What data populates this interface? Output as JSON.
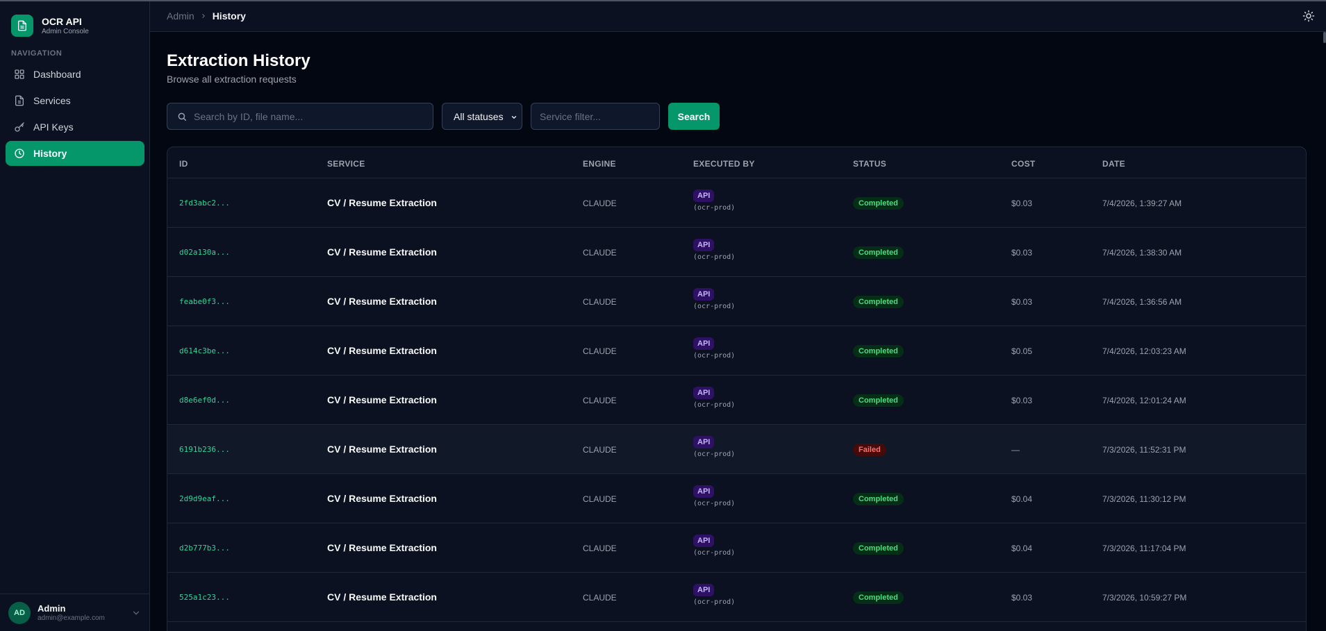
{
  "app": {
    "title": "OCR API",
    "subtitle": "Admin Console",
    "logo_icon": "document-icon"
  },
  "sidebar": {
    "heading": "NAVIGATION",
    "items": [
      {
        "label": "Dashboard",
        "icon": "grid-icon",
        "active": false
      },
      {
        "label": "Services",
        "icon": "file-icon",
        "active": false
      },
      {
        "label": "API Keys",
        "icon": "key-icon",
        "active": false
      },
      {
        "label": "History",
        "icon": "clock-icon",
        "active": true
      }
    ],
    "user": {
      "initials": "AD",
      "name": "Admin",
      "email": "admin@example.com"
    }
  },
  "header": {
    "breadcrumb_root": "Admin",
    "breadcrumb_current": "History",
    "theme_icon": "sun-icon"
  },
  "page": {
    "title": "Extraction History",
    "subtitle": "Browse all extraction requests"
  },
  "filters": {
    "search_placeholder": "Search by ID, file name...",
    "status_value": "All statuses",
    "service_placeholder": "Service filter...",
    "search_button": "Search"
  },
  "table": {
    "columns": {
      "id": "ID",
      "service": "SERVICE",
      "engine": "ENGINE",
      "executed_by": "EXECUTED BY",
      "status": "STATUS",
      "cost": "COST",
      "date": "DATE"
    },
    "rows": [
      {
        "id": "2fd3abc2...",
        "service": "CV / Resume Extraction",
        "engine": "CLAUDE",
        "executed_by": "API",
        "key": "(ocr-prod)",
        "status": "Completed",
        "cost": "$0.03",
        "date": "7/4/2026, 1:39:27 AM"
      },
      {
        "id": "d02a130a...",
        "service": "CV / Resume Extraction",
        "engine": "CLAUDE",
        "executed_by": "API",
        "key": "(ocr-prod)",
        "status": "Completed",
        "cost": "$0.03",
        "date": "7/4/2026, 1:38:30 AM"
      },
      {
        "id": "feabe0f3...",
        "service": "CV / Resume Extraction",
        "engine": "CLAUDE",
        "executed_by": "API",
        "key": "(ocr-prod)",
        "status": "Completed",
        "cost": "$0.03",
        "date": "7/4/2026, 1:36:56 AM"
      },
      {
        "id": "d614c3be...",
        "service": "CV / Resume Extraction",
        "engine": "CLAUDE",
        "executed_by": "API",
        "key": "(ocr-prod)",
        "status": "Completed",
        "cost": "$0.05",
        "date": "7/4/2026, 12:03:23 AM"
      },
      {
        "id": "d8e6ef0d...",
        "service": "CV / Resume Extraction",
        "engine": "CLAUDE",
        "executed_by": "API",
        "key": "(ocr-prod)",
        "status": "Completed",
        "cost": "$0.03",
        "date": "7/4/2026, 12:01:24 AM"
      },
      {
        "id": "6191b236...",
        "service": "CV / Resume Extraction",
        "engine": "CLAUDE",
        "executed_by": "API",
        "key": "(ocr-prod)",
        "status": "Failed",
        "cost": "—",
        "date": "7/3/2026, 11:52:31 PM"
      },
      {
        "id": "2d9d9eaf...",
        "service": "CV / Resume Extraction",
        "engine": "CLAUDE",
        "executed_by": "API",
        "key": "(ocr-prod)",
        "status": "Completed",
        "cost": "$0.04",
        "date": "7/3/2026, 11:30:12 PM"
      },
      {
        "id": "d2b777b3...",
        "service": "CV / Resume Extraction",
        "engine": "CLAUDE",
        "executed_by": "API",
        "key": "(ocr-prod)",
        "status": "Completed",
        "cost": "$0.04",
        "date": "7/3/2026, 11:17:04 PM"
      },
      {
        "id": "525a1c23...",
        "service": "CV / Resume Extraction",
        "engine": "CLAUDE",
        "executed_by": "API",
        "key": "(ocr-prod)",
        "status": "Completed",
        "cost": "$0.03",
        "date": "7/3/2026, 10:59:27 PM"
      }
    ]
  },
  "colors": {
    "accent": "#059669",
    "background": "#030712",
    "sidebar": "#0b1120",
    "id_text": "#34d399",
    "completed": "#4ade80",
    "failed": "#f87171"
  }
}
